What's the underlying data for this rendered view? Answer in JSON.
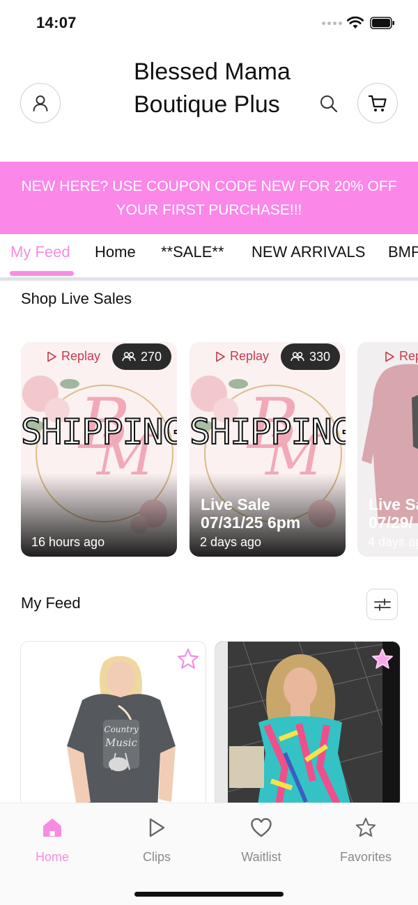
{
  "status_bar": {
    "time": "14:07"
  },
  "header": {
    "store_title": "Blessed Mama Boutique Plus",
    "account_icon": "user-icon",
    "search_icon": "search-icon",
    "cart_icon": "cart-icon"
  },
  "promo": {
    "line1": "NEW HERE? USE COUPON CODE NEW FOR 20% OFF",
    "line2": "YOUR FIRST PURCHASE!!!",
    "background": "#fb87e9"
  },
  "nav_tabs": [
    {
      "label": "My Feed",
      "active": true
    },
    {
      "label": "Home",
      "active": false
    },
    {
      "label": "**SALE**",
      "active": false
    },
    {
      "label": "NEW ARRIVALS",
      "active": false
    },
    {
      "label": "BMP",
      "active": false
    }
  ],
  "live_sales": {
    "title": "Shop Live Sales",
    "cards": [
      {
        "replay_label": "Replay",
        "viewers": "270",
        "artwork_text": "SHIPPING",
        "title_line1": "",
        "title_line2": "",
        "time_ago": "16 hours ago"
      },
      {
        "replay_label": "Replay",
        "viewers": "330",
        "artwork_text": "SHIPPING",
        "title_line1": "Live Sale",
        "title_line2": "07/31/25 6pm",
        "time_ago": "2 days ago"
      },
      {
        "replay_label": "Rep",
        "viewers": "",
        "artwork_text": "",
        "title_line1": "Live Sa",
        "title_line2": "07/29/",
        "time_ago": "4 days ag"
      }
    ]
  },
  "feed": {
    "title": "My Feed",
    "filter_icon": "sliders-icon",
    "products": [
      {
        "image": "woman in gray Country Music graphic tee",
        "favorite_icon": "star-outline-icon"
      },
      {
        "image": "woman in multicolor print off-shoulder dress",
        "favorite_icon": "star-filled-icon"
      }
    ]
  },
  "bottom_nav": [
    {
      "label": "Home",
      "icon": "home-icon",
      "active": true
    },
    {
      "label": "Clips",
      "icon": "play-icon",
      "active": false
    },
    {
      "label": "Waitlist",
      "icon": "heart-icon",
      "active": false
    },
    {
      "label": "Favorites",
      "icon": "star-icon",
      "active": false
    }
  ],
  "colors": {
    "accent": "#f58ee3",
    "promo": "#fb87e9",
    "replay": "#c53a4d"
  }
}
